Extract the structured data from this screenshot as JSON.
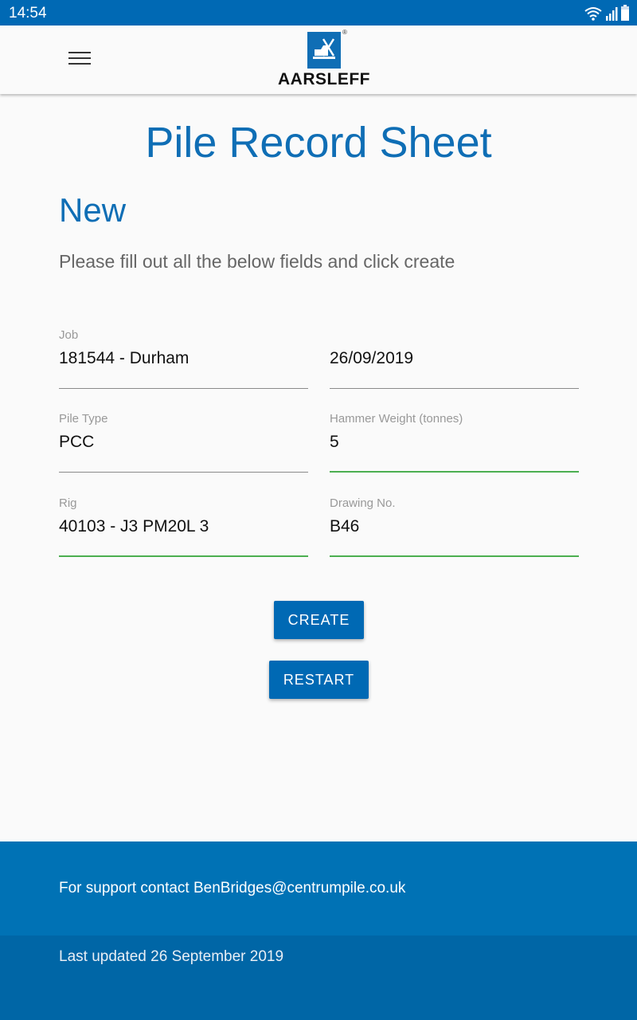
{
  "status_bar": {
    "time": "14:54",
    "icons": [
      "wifi-icon",
      "signal-icon",
      "battery-icon"
    ]
  },
  "app_bar": {
    "menu_icon": "hamburger-menu-icon",
    "logo_text": "AARSLEFF"
  },
  "page": {
    "title": "Pile Record Sheet",
    "section_title": "New",
    "instructions": "Please fill out all the below fields and click create"
  },
  "form": {
    "job": {
      "label": "Job",
      "value": "181544 - Durham"
    },
    "date": {
      "label": "",
      "value": "26/09/2019"
    },
    "pile_type": {
      "label": "Pile Type",
      "value": "PCC"
    },
    "hammer_weight": {
      "label": "Hammer Weight (tonnes)",
      "value": "5"
    },
    "rig": {
      "label": "Rig",
      "value": "40103 - J3 PM20L 3"
    },
    "drawing_no": {
      "label": "Drawing No.",
      "value": "B46"
    }
  },
  "actions": {
    "create_label": "CREATE",
    "restart_label": "RESTART"
  },
  "footer": {
    "support": "For support contact BenBridges@centrumpile.co.uk",
    "last_updated": "Last updated 26 September 2019"
  },
  "colors": {
    "primary": "#0069b4",
    "title_blue": "#0f6eb5",
    "valid_green": "#4caf50",
    "footer_top": "#0072b5",
    "footer_bottom": "#0066a6"
  }
}
